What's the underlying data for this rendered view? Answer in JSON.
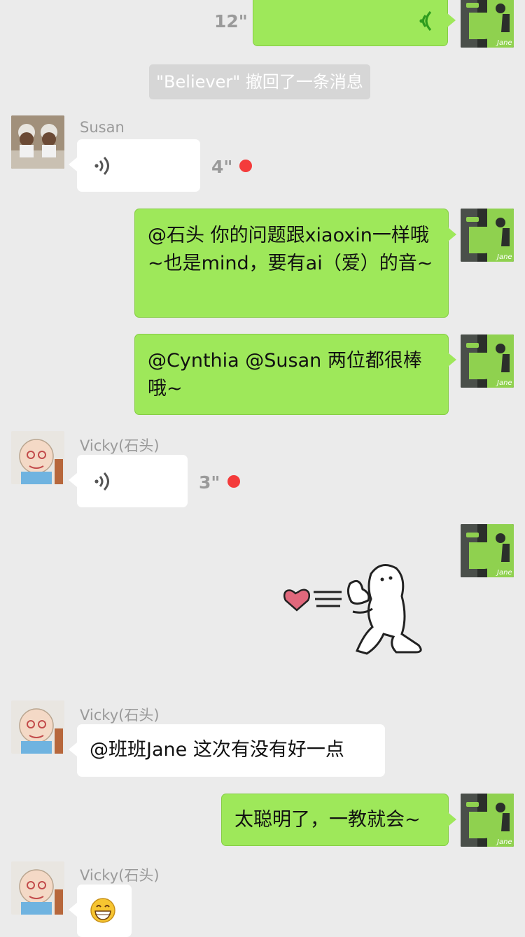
{
  "colors": {
    "background": "#ebebeb",
    "bubble_self": "#9ee85a",
    "bubble_other": "#ffffff",
    "unread_dot": "#f43b3b",
    "system_bg": "#d6d6d6"
  },
  "messages": [
    {
      "id": "m1",
      "sender": "Jane",
      "type": "voice",
      "duration": "12\""
    },
    {
      "id": "m2",
      "type": "system",
      "text": "\"Believer\" 撤回了一条消息"
    },
    {
      "id": "m3",
      "sender": "Susan",
      "type": "voice",
      "duration": "4\"",
      "unread": true
    },
    {
      "id": "m4",
      "sender": "Jane",
      "type": "text",
      "text": "@石头 你的问题跟xiaoxin一样哦~也是mind，要有ai（爱）的音~"
    },
    {
      "id": "m5",
      "sender": "Jane",
      "type": "text",
      "text": "@Cynthia  @Susan 两位都很棒哦~"
    },
    {
      "id": "m6",
      "sender": "Vicky(石头)",
      "type": "voice",
      "duration": "3\"",
      "unread": true
    },
    {
      "id": "m7",
      "sender": "Jane",
      "type": "sticker",
      "sticker": "heart-kneeling-sticker"
    },
    {
      "id": "m8",
      "sender": "Vicky(石头)",
      "type": "text",
      "text": "@班班Jane 这次有没有好一点"
    },
    {
      "id": "m9",
      "sender": "Jane",
      "type": "text",
      "text": "太聪明了，一教就会~"
    },
    {
      "id": "m10",
      "sender": "Vicky(石头)",
      "type": "emoji",
      "emoji": "grinning-emoji"
    }
  ],
  "labels": {
    "susan_name": "Susan",
    "vicky_name_1": "Vicky(石头)",
    "vicky_name_2": "Vicky(石头)",
    "vicky_name_3": "Vicky(石头)",
    "jane_avatar_text": "Jane",
    "dur_12": "12\"",
    "dur_4": "4\"",
    "dur_3": "3\"",
    "system_recall": "\"Believer\" 撤回了一条消息",
    "msg_shitou": "@石头 你的问题跟xiaoxin一样哦~也是mind，要有ai（爱）的音~",
    "msg_cynthia": "@Cynthia  @Susan 两位都很棒哦~",
    "msg_banban": "@班班Jane 这次有没有好一点",
    "msg_smart": "太聪明了，一教就会~"
  }
}
